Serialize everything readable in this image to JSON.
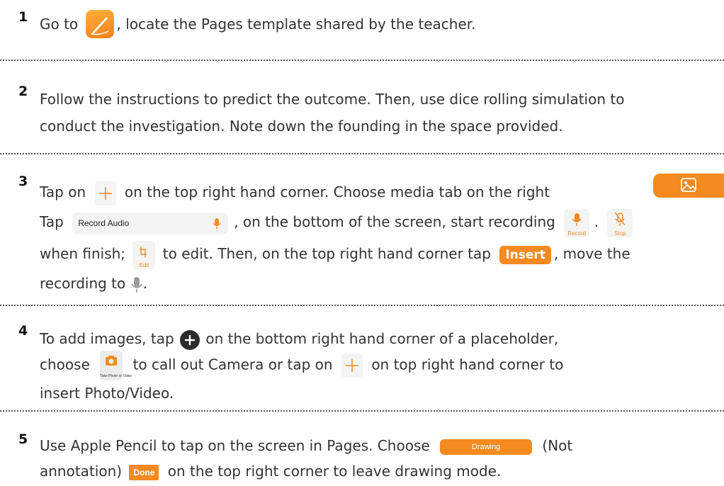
{
  "steps": [
    {
      "number": "1",
      "parts": [
        "Go to",
        ", locate the Pages template shared by the teacher."
      ]
    },
    {
      "number": "2",
      "lines": [
        "Follow the instructions to predict the outcome. Then, use dice rolling simulation to",
        "conduct the investigation. Note down the founding in the space provided."
      ]
    },
    {
      "number": "3",
      "line1": [
        "Tap on",
        "on the top right hand corner. Choose media tab on the right"
      ],
      "line2": [
        "Tap",
        ", on the bottom of the screen, start recording",
        "."
      ],
      "record_audio_label": "Record Audio",
      "record_caption": "Record",
      "stop_caption": "Stop",
      "edit_caption": "Edit",
      "line3": [
        "when finish;",
        "to edit. Then, on the top right hand corner tap",
        ", move the"
      ],
      "insert_label": "Insert",
      "line4": [
        "recording to",
        "."
      ]
    },
    {
      "number": "4",
      "line1": [
        "To add images, tap",
        "on the bottom right hand corner of a placeholder,"
      ],
      "line2": [
        "choose",
        "to call out Camera or tap on",
        "on top right hand corner to"
      ],
      "photo_caption": "Take Photo or Video",
      "line3": "insert Photo/Video."
    },
    {
      "number": "5",
      "line1": [
        "Use Apple Pencil to tap on the screen in Pages. Choose",
        "(Not"
      ],
      "drawing_label": "Drawing",
      "line2": [
        "annotation)",
        "on the top right corner to leave drawing mode."
      ],
      "done_label": "Done"
    }
  ],
  "colors": {
    "accent": "#f58a1f",
    "text": "#333333",
    "divider": "#555555"
  },
  "icons": [
    "pages-app-icon",
    "plus-icon",
    "media-icon",
    "microphone-icon",
    "record-icon",
    "stop-icon",
    "edit-trim-icon",
    "mic-placeholder-icon",
    "add-circle-icon",
    "camera-icon"
  ]
}
